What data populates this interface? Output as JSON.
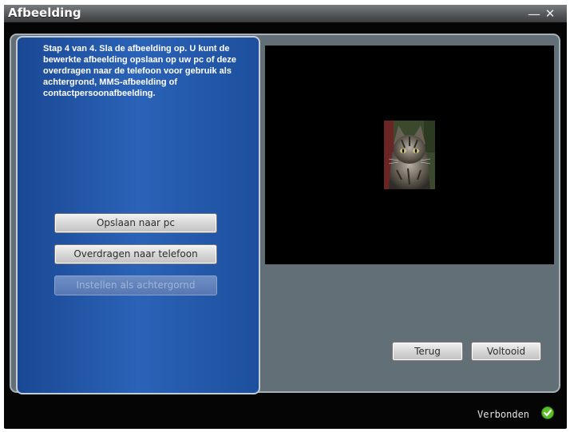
{
  "window": {
    "title": "Afbeelding",
    "minimize_glyph": "—",
    "close_glyph": "✕"
  },
  "instructions": "Stap 4 van 4. Sla de afbeelding op. U kunt de bewerkte afbeelding opslaan op uw pc of deze overdragen naar de telefoon voor gebruik als achtergrond, MMS-afbeelding of contactpersoonafbeelding.",
  "actions": {
    "save_pc": "Opslaan naar pc",
    "transfer_phone": "Overdragen naar telefoon",
    "set_background": "Instellen als achtergornd"
  },
  "nav": {
    "back": "Terug",
    "finish": "Voltooid"
  },
  "status": {
    "text": "Verbonden",
    "icon": "check-circle-icon",
    "color": "#5cbf2a"
  },
  "preview": {
    "image_subject": "cat-photo"
  },
  "colors": {
    "panel_blue": "#2b63b8",
    "frame_gray": "#626f77"
  }
}
